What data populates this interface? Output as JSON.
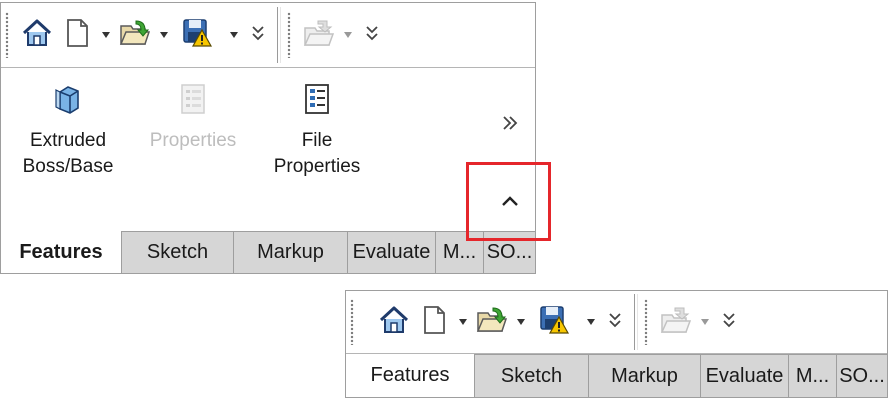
{
  "commands": {
    "extrude_line1": "Extruded",
    "extrude_line2": "Boss/Base",
    "properties": "Properties",
    "file_props_line1": "File",
    "file_props_line2": "Properties"
  },
  "tabs": [
    "Features",
    "Sketch",
    "Markup",
    "Evaluate",
    "M...",
    "SO..."
  ],
  "icons": {
    "home": "home-icon",
    "new": "new-document-icon",
    "open": "open-folder-icon",
    "save": "save-warning-icon",
    "disabled_folder": "disabled-folder-icon",
    "overflow": "double-chevron-down-icon",
    "more": "double-chevron-right-icon",
    "collapse": "chevron-up-icon"
  },
  "colors": {
    "highlight": "#e5262b",
    "inactive_tab": "#d6d6d6",
    "disabled_text": "#bdbdbd"
  }
}
